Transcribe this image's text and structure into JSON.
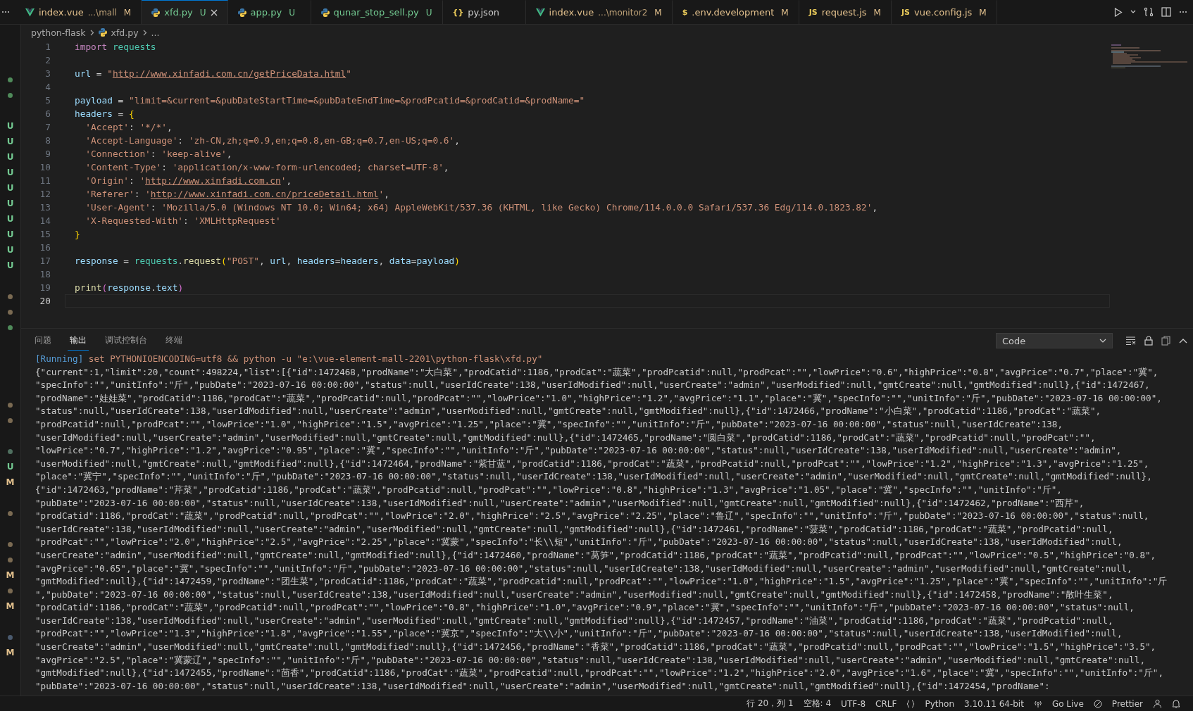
{
  "tabs": [
    {
      "label": "index.vue",
      "detail": "...\\mall",
      "status": "M",
      "color": "#e2c08d",
      "kind": "vue",
      "selected": false
    },
    {
      "label": "xfd.py",
      "status": "U",
      "color": "#73c991",
      "kind": "python",
      "selected": true
    },
    {
      "label": "app.py",
      "status": "U",
      "color": "#73c991",
      "kind": "python",
      "selected": false
    },
    {
      "label": "qunar_stop_sell.py",
      "status": "U",
      "color": "#73c991",
      "kind": "python",
      "selected": false
    },
    {
      "label": "py.json",
      "color": "#cccccc",
      "kind": "glyph",
      "glyph": "{}",
      "selected": false
    },
    {
      "label": "index.vue",
      "detail": "...\\monitor2",
      "status": "M",
      "color": "#e2c08d",
      "kind": "vue",
      "selected": false
    },
    {
      "label": ".env.development",
      "status": "M",
      "color": "#e2c08d",
      "kind": "glyph",
      "glyph": "$",
      "selected": false
    },
    {
      "label": "request.js",
      "status": "M",
      "color": "#e2c08d",
      "kind": "glyph",
      "glyph": "JS",
      "selected": false
    },
    {
      "label": "vue.config.js",
      "status": "M",
      "color": "#e2c08d",
      "kind": "glyph",
      "glyph": "JS",
      "selected": false
    }
  ],
  "breadcrumb": {
    "folder": "python-flask",
    "file": "xfd.py",
    "more": "..."
  },
  "explorer_marks": [
    {
      "kind": "dot",
      "color": "#4f8a5a"
    },
    {
      "kind": "dot",
      "color": "#4f8a5a"
    },
    {
      "kind": "plain"
    },
    {
      "kind": "letter",
      "text": "U",
      "color": "#73c991"
    },
    {
      "kind": "letter",
      "text": "U",
      "color": "#73c991"
    },
    {
      "kind": "letter",
      "text": "U",
      "color": "#73c991"
    },
    {
      "kind": "letter",
      "text": "U",
      "color": "#73c991"
    },
    {
      "kind": "letter",
      "text": "U",
      "color": "#73c991"
    },
    {
      "kind": "letter",
      "text": "U",
      "color": "#73c991"
    },
    {
      "kind": "letter",
      "text": "U",
      "color": "#73c991"
    },
    {
      "kind": "letter",
      "text": "U",
      "color": "#73c991"
    },
    {
      "kind": "letter",
      "text": "U",
      "color": "#73c991"
    },
    {
      "kind": "letter",
      "text": "U",
      "color": "#73c991"
    },
    {
      "kind": "plain"
    },
    {
      "kind": "dot",
      "color": "#7a6a52"
    },
    {
      "kind": "dot",
      "color": "#7a6a52"
    },
    {
      "kind": "dot",
      "color": "#4f8a5a"
    },
    {
      "kind": "plain"
    },
    {
      "kind": "plain"
    },
    {
      "kind": "plain"
    },
    {
      "kind": "plain"
    },
    {
      "kind": "dot",
      "color": "#7a6a52"
    },
    {
      "kind": "dot",
      "color": "#7a6a52"
    },
    {
      "kind": "plain"
    },
    {
      "kind": "dot",
      "color": "#4f6f5f"
    },
    {
      "kind": "letter",
      "text": "U",
      "color": "#73c991"
    },
    {
      "kind": "letter",
      "text": "M",
      "color": "#e2c08d"
    },
    {
      "kind": "plain"
    },
    {
      "kind": "dot",
      "color": "#7a6a52"
    },
    {
      "kind": "plain"
    },
    {
      "kind": "dot",
      "color": "#7a6a52"
    },
    {
      "kind": "dot",
      "color": "#7a6a52"
    },
    {
      "kind": "letter",
      "text": "M",
      "color": "#e2c08d"
    },
    {
      "kind": "dot",
      "color": "#7a6a52"
    },
    {
      "kind": "letter",
      "text": "M",
      "color": "#e2c08d"
    },
    {
      "kind": "plain"
    },
    {
      "kind": "dot",
      "color": "#4a5a6e"
    },
    {
      "kind": "letter",
      "text": "M",
      "color": "#e2c08d"
    }
  ],
  "code": [
    {
      "number": "1",
      "current": false,
      "tokens": [
        {
          "text": "import",
          "kind": "kw"
        },
        {
          "text": "requests",
          "kind": "mod"
        }
      ]
    },
    {
      "number": "2",
      "current": false
    },
    {
      "number": "3",
      "current": false,
      "tokens": [
        {
          "text": "url",
          "kind": "var"
        },
        {
          "text": "=",
          "kind": "op"
        },
        {
          "text": "\"",
          "kind": "str"
        },
        {
          "text": "http://www.xinfadi.com.cn/getPriceData.html",
          "kind": "link"
        },
        {
          "text": "\"",
          "kind": "str"
        }
      ]
    },
    {
      "number": "4",
      "current": false
    },
    {
      "number": "5",
      "current": false,
      "tokens": [
        {
          "text": "payload",
          "kind": "var"
        },
        {
          "text": "=",
          "kind": "op"
        },
        {
          "text": "\"limit=&current=&pubDateStartTime=&pubDateEndTime=&prodPcatid=&prodCatid=&prodName=\"",
          "kind": "str"
        }
      ]
    },
    {
      "number": "6",
      "current": false,
      "tokens": [
        {
          "text": "headers",
          "kind": "var"
        },
        {
          "text": "=",
          "kind": "op"
        },
        {
          "text": "{",
          "kind": "brace"
        }
      ]
    },
    {
      "number": "7",
      "current": false,
      "tokens": [
        {
          "text": "'Accept'",
          "kind": "key"
        },
        {
          "text": ":",
          "kind": "colon"
        },
        {
          "text": "'*/*'",
          "kind": "str"
        },
        {
          "text": ",",
          "kind": "comma"
        }
      ]
    },
    {
      "number": "8",
      "current": false,
      "tokens": [
        {
          "text": "'Accept-Language'",
          "kind": "key"
        },
        {
          "text": ":",
          "kind": "colon"
        },
        {
          "text": "'zh-CN,zh;q=0.9,en;q=0.8,en-GB;q=0.7,en-US;q=0.6'",
          "kind": "str"
        },
        {
          "text": ",",
          "kind": "comma"
        }
      ]
    },
    {
      "number": "9",
      "current": false,
      "tokens": [
        {
          "text": "'Connection'",
          "kind": "key"
        },
        {
          "text": ":",
          "kind": "colon"
        },
        {
          "text": "'keep-alive'",
          "kind": "str"
        },
        {
          "text": ",",
          "kind": "comma"
        }
      ]
    },
    {
      "number": "10",
      "current": false,
      "tokens": [
        {
          "text": "'Content-Type'",
          "kind": "key"
        },
        {
          "text": ":",
          "kind": "colon"
        },
        {
          "text": "'application/x-www-form-urlencoded; charset=UTF-8'",
          "kind": "str"
        },
        {
          "text": ",",
          "kind": "comma"
        }
      ]
    },
    {
      "number": "11",
      "current": false,
      "tokens": [
        {
          "text": "'Origin'",
          "kind": "key"
        },
        {
          "text": ":",
          "kind": "colon"
        },
        {
          "text": "'",
          "kind": "str"
        },
        {
          "text": "http://www.xinfadi.com.cn",
          "kind": "link"
        },
        {
          "text": "'",
          "kind": "str"
        },
        {
          "text": ",",
          "kind": "comma"
        }
      ]
    },
    {
      "number": "12",
      "current": false,
      "tokens": [
        {
          "text": "'Referer'",
          "kind": "key"
        },
        {
          "text": ":",
          "kind": "colon"
        },
        {
          "text": "'",
          "kind": "str"
        },
        {
          "text": "http://www.xinfadi.com.cn/priceDetail.html",
          "kind": "link"
        },
        {
          "text": "'",
          "kind": "str"
        },
        {
          "text": ",",
          "kind": "comma"
        }
      ]
    },
    {
      "number": "13",
      "current": false,
      "tokens": [
        {
          "text": "'User-Agent'",
          "kind": "key"
        },
        {
          "text": ":",
          "kind": "colon"
        },
        {
          "text": "'Mozilla/5.0 (Windows NT 10.0; Win64; x64) AppleWebKit/537.36 (KHTML, like Gecko) Chrome/114.0.0.0 Safari/537.36 Edg/114.0.1823.82'",
          "kind": "str"
        },
        {
          "text": ",",
          "kind": "comma"
        }
      ]
    },
    {
      "number": "14",
      "current": false,
      "tokens": [
        {
          "text": "'X-Requested-With'",
          "kind": "key"
        },
        {
          "text": ":",
          "kind": "colon"
        },
        {
          "text": "'XMLHttpRequest'",
          "kind": "str"
        }
      ]
    },
    {
      "number": "15",
      "current": false,
      "tokens": [
        {
          "text": "}",
          "kind": "close"
        }
      ]
    },
    {
      "number": "16",
      "current": false
    },
    {
      "number": "17",
      "current": false,
      "tokens": [
        {
          "text": "response",
          "kind": "var"
        },
        {
          "text": "=",
          "kind": "op"
        },
        {
          "text": "requests",
          "kind": "mod"
        },
        {
          "text": ".",
          "kind": "dot"
        },
        {
          "text": "request",
          "kind": "fn"
        },
        {
          "text": "(",
          "kind": "brace"
        },
        {
          "text": "\"POST\"",
          "kind": "str"
        },
        {
          "text": ",",
          "kind": "comma"
        },
        {
          "text": "url",
          "kind": "var"
        },
        {
          "text": ",",
          "kind": "comma"
        },
        {
          "text": "headers",
          "kind": "var"
        },
        {
          "text": "=",
          "kind": "eq"
        },
        {
          "text": "headers",
          "kind": "var"
        },
        {
          "text": ",",
          "kind": "comma"
        },
        {
          "text": "data",
          "kind": "var"
        },
        {
          "text": "=",
          "kind": "eq"
        },
        {
          "text": "payload",
          "kind": "var"
        },
        {
          "text": ")",
          "kind": "brace"
        }
      ]
    },
    {
      "number": "18",
      "current": false
    },
    {
      "number": "19",
      "current": false,
      "tokens": [
        {
          "text": "print",
          "kind": "fn"
        },
        {
          "text": "(",
          "kind": "paren"
        },
        {
          "text": "response",
          "kind": "var"
        },
        {
          "text": ".",
          "kind": "dot"
        },
        {
          "text": "text",
          "kind": "var"
        },
        {
          "text": ")",
          "kind": "paren"
        }
      ]
    },
    {
      "number": "20",
      "current": true
    }
  ],
  "panel": {
    "tabs": [
      {
        "label": "问题",
        "selected": false
      },
      {
        "label": "输出",
        "selected": true
      },
      {
        "label": "调试控制台",
        "selected": false
      },
      {
        "label": "终端",
        "selected": false
      }
    ],
    "channel": "Code",
    "running": "[Running]",
    "command": "set PYTHONIOENCODING=utf8 && python -u \"e:\\vue-element-mall-2201\\python-flask\\xfd.py\"",
    "lines": [
      "{\"current\":1,\"limit\":20,\"count\":498224,\"list\":[{\"id\":1472468,\"prodName\":\"大白菜\",\"prodCatid\":1186,\"prodCat\":\"蔬菜\",\"prodPcatid\":null,\"prodPcat\":\"\",\"lowPrice\":\"0.6\",\"highPrice\":\"0.8\",\"avgPrice\":\"0.7\",\"place\":\"冀\",",
      "\"specInfo\":\"\",\"unitInfo\":\"斤\",\"pubDate\":\"2023-07-16 00:00:00\",\"status\":null,\"userIdCreate\":138,\"userIdModified\":null,\"userCreate\":\"admin\",\"userModified\":null,\"gmtCreate\":null,\"gmtModified\":null},{\"id\":1472467,",
      "\"prodName\":\"娃娃菜\",\"prodCatid\":1186,\"prodCat\":\"蔬菜\",\"prodPcatid\":null,\"prodPcat\":\"\",\"lowPrice\":\"1.0\",\"highPrice\":\"1.2\",\"avgPrice\":\"1.1\",\"place\":\"冀\",\"specInfo\":\"\",\"unitInfo\":\"斤\",\"pubDate\":\"2023-07-16 00:00:00\",",
      "\"status\":null,\"userIdCreate\":138,\"userIdModified\":null,\"userCreate\":\"admin\",\"userModified\":null,\"gmtCreate\":null,\"gmtModified\":null},{\"id\":1472466,\"prodName\":\"小白菜\",\"prodCatid\":1186,\"prodCat\":\"蔬菜\",",
      "\"prodPcatid\":null,\"prodPcat\":\"\",\"lowPrice\":\"1.0\",\"highPrice\":\"1.5\",\"avgPrice\":\"1.25\",\"place\":\"冀\",\"specInfo\":\"\",\"unitInfo\":\"斤\",\"pubDate\":\"2023-07-16 00:00:00\",\"status\":null,\"userIdCreate\":138,",
      "\"userIdModified\":null,\"userCreate\":\"admin\",\"userModified\":null,\"gmtCreate\":null,\"gmtModified\":null},{\"id\":1472465,\"prodName\":\"圆白菜\",\"prodCatid\":1186,\"prodCat\":\"蔬菜\",\"prodPcatid\":null,\"prodPcat\":\"\",",
      "\"lowPrice\":\"0.7\",\"highPrice\":\"1.2\",\"avgPrice\":\"0.95\",\"place\":\"冀\",\"specInfo\":\"\",\"unitInfo\":\"斤\",\"pubDate\":\"2023-07-16 00:00:00\",\"status\":null,\"userIdCreate\":138,\"userIdModified\":null,\"userCreate\":\"admin\",",
      "\"userModified\":null,\"gmtCreate\":null,\"gmtModified\":null},{\"id\":1472464,\"prodName\":\"紫甘蓝\",\"prodCatid\":1186,\"prodCat\":\"蔬菜\",\"prodPcatid\":null,\"prodPcat\":\"\",\"lowPrice\":\"1.2\",\"highPrice\":\"1.3\",\"avgPrice\":\"1.25\",",
      "\"place\":\"冀宁\",\"specInfo\":\"\",\"unitInfo\":\"斤\",\"pubDate\":\"2023-07-16 00:00:00\",\"status\":null,\"userIdCreate\":138,\"userIdModified\":null,\"userCreate\":\"admin\",\"userModified\":null,\"gmtCreate\":null,\"gmtModified\":null},",
      "{\"id\":1472463,\"prodName\":\"芹菜\",\"prodCatid\":1186,\"prodCat\":\"蔬菜\",\"prodPcatid\":null,\"prodPcat\":\"\",\"lowPrice\":\"0.8\",\"highPrice\":\"1.3\",\"avgPrice\":\"1.05\",\"place\":\"冀\",\"specInfo\":\"\",\"unitInfo\":\"斤\",",
      "\"pubDate\":\"2023-07-16 00:00:00\",\"status\":null,\"userIdCreate\":138,\"userIdModified\":null,\"userCreate\":\"admin\",\"userModified\":null,\"gmtCreate\":null,\"gmtModified\":null},{\"id\":1472462,\"prodName\":\"西芹\",",
      "\"prodCatid\":1186,\"prodCat\":\"蔬菜\",\"prodPcatid\":null,\"prodPcat\":\"\",\"lowPrice\":\"2.0\",\"highPrice\":\"2.5\",\"avgPrice\":\"2.25\",\"place\":\"鲁辽\",\"specInfo\":\"\",\"unitInfo\":\"斤\",\"pubDate\":\"2023-07-16 00:00:00\",\"status\":null,",
      "\"userIdCreate\":138,\"userIdModified\":null,\"userCreate\":\"admin\",\"userModified\":null,\"gmtCreate\":null,\"gmtModified\":null},{\"id\":1472461,\"prodName\":\"菠菜\",\"prodCatid\":1186,\"prodCat\":\"蔬菜\",\"prodPcatid\":null,",
      "\"prodPcat\":\"\",\"lowPrice\":\"2.0\",\"highPrice\":\"2.5\",\"avgPrice\":\"2.25\",\"place\":\"冀蒙\",\"specInfo\":\"长\\\\短\",\"unitInfo\":\"斤\",\"pubDate\":\"2023-07-16 00:00:00\",\"status\":null,\"userIdCreate\":138,\"userIdModified\":null,",
      "\"userCreate\":\"admin\",\"userModified\":null,\"gmtCreate\":null,\"gmtModified\":null},{\"id\":1472460,\"prodName\":\"莴笋\",\"prodCatid\":1186,\"prodCat\":\"蔬菜\",\"prodPcatid\":null,\"prodPcat\":\"\",\"lowPrice\":\"0.5\",\"highPrice\":\"0.8\",",
      "\"avgPrice\":\"0.65\",\"place\":\"冀\",\"specInfo\":\"\",\"unitInfo\":\"斤\",\"pubDate\":\"2023-07-16 00:00:00\",\"status\":null,\"userIdCreate\":138,\"userIdModified\":null,\"userCreate\":\"admin\",\"userModified\":null,\"gmtCreate\":null,",
      "\"gmtModified\":null},{\"id\":1472459,\"prodName\":\"团生菜\",\"prodCatid\":1186,\"prodCat\":\"蔬菜\",\"prodPcatid\":null,\"prodPcat\":\"\",\"lowPrice\":\"1.0\",\"highPrice\":\"1.5\",\"avgPrice\":\"1.25\",\"place\":\"冀\",\"specInfo\":\"\",\"unitInfo\":\"斤",
      "\",\"pubDate\":\"2023-07-16 00:00:00\",\"status\":null,\"userIdCreate\":138,\"userIdModified\":null,\"userCreate\":\"admin\",\"userModified\":null,\"gmtCreate\":null,\"gmtModified\":null},{\"id\":1472458,\"prodName\":\"散叶生菜\",",
      "\"prodCatid\":1186,\"prodCat\":\"蔬菜\",\"prodPcatid\":null,\"prodPcat\":\"\",\"lowPrice\":\"0.8\",\"highPrice\":\"1.0\",\"avgPrice\":\"0.9\",\"place\":\"冀\",\"specInfo\":\"\",\"unitInfo\":\"斤\",\"pubDate\":\"2023-07-16 00:00:00\",\"status\":null,",
      "\"userIdCreate\":138,\"userIdModified\":null,\"userCreate\":\"admin\",\"userModified\":null,\"gmtCreate\":null,\"gmtModified\":null},{\"id\":1472457,\"prodName\":\"油菜\",\"prodCatid\":1186,\"prodCat\":\"蔬菜\",\"prodPcatid\":null,",
      "\"prodPcat\":\"\",\"lowPrice\":\"1.3\",\"highPrice\":\"1.8\",\"avgPrice\":\"1.55\",\"place\":\"冀京\",\"specInfo\":\"大\\\\小\",\"unitInfo\":\"斤\",\"pubDate\":\"2023-07-16 00:00:00\",\"status\":null,\"userIdCreate\":138,\"userIdModified\":null,",
      "\"userCreate\":\"admin\",\"userModified\":null,\"gmtCreate\":null,\"gmtModified\":null},{\"id\":1472456,\"prodName\":\"香菜\",\"prodCatid\":1186,\"prodCat\":\"蔬菜\",\"prodPcatid\":null,\"prodPcat\":\"\",\"lowPrice\":\"1.5\",\"highPrice\":\"3.5\",",
      "\"avgPrice\":\"2.5\",\"place\":\"冀蒙辽\",\"specInfo\":\"\",\"unitInfo\":\"斤\",\"pubDate\":\"2023-07-16 00:00:00\",\"status\":null,\"userIdCreate\":138,\"userIdModified\":null,\"userCreate\":\"admin\",\"userModified\":null,\"gmtCreate\":null,",
      "\"gmtModified\":null},{\"id\":1472455,\"prodName\":\"茴香\",\"prodCatid\":1186,\"prodCat\":\"蔬菜\",\"prodPcatid\":null,\"prodPcat\":\"\",\"lowPrice\":\"1.2\",\"highPrice\":\"2.0\",\"avgPrice\":\"1.6\",\"place\":\"冀\",\"specInfo\":\"\",\"unitInfo\":\"斤\",",
      "\"pubDate\":\"2023-07-16 00:00:00\",\"status\":null,\"userIdCreate\":138,\"userIdModified\":null,\"userCreate\":\"admin\",\"userModified\":null,\"gmtCreate\":null,\"gmtModified\":null},{\"id\":1472454,\"prodName\":"
    ]
  },
  "status_bar": {
    "position": "行 20，列 1",
    "indent": "空格: 4",
    "encoding": "UTF-8",
    "eol": "CRLF",
    "language": "Python",
    "interpreter": "3.10.11 64-bit",
    "live": "Go Live",
    "formatter": "Prettier"
  }
}
